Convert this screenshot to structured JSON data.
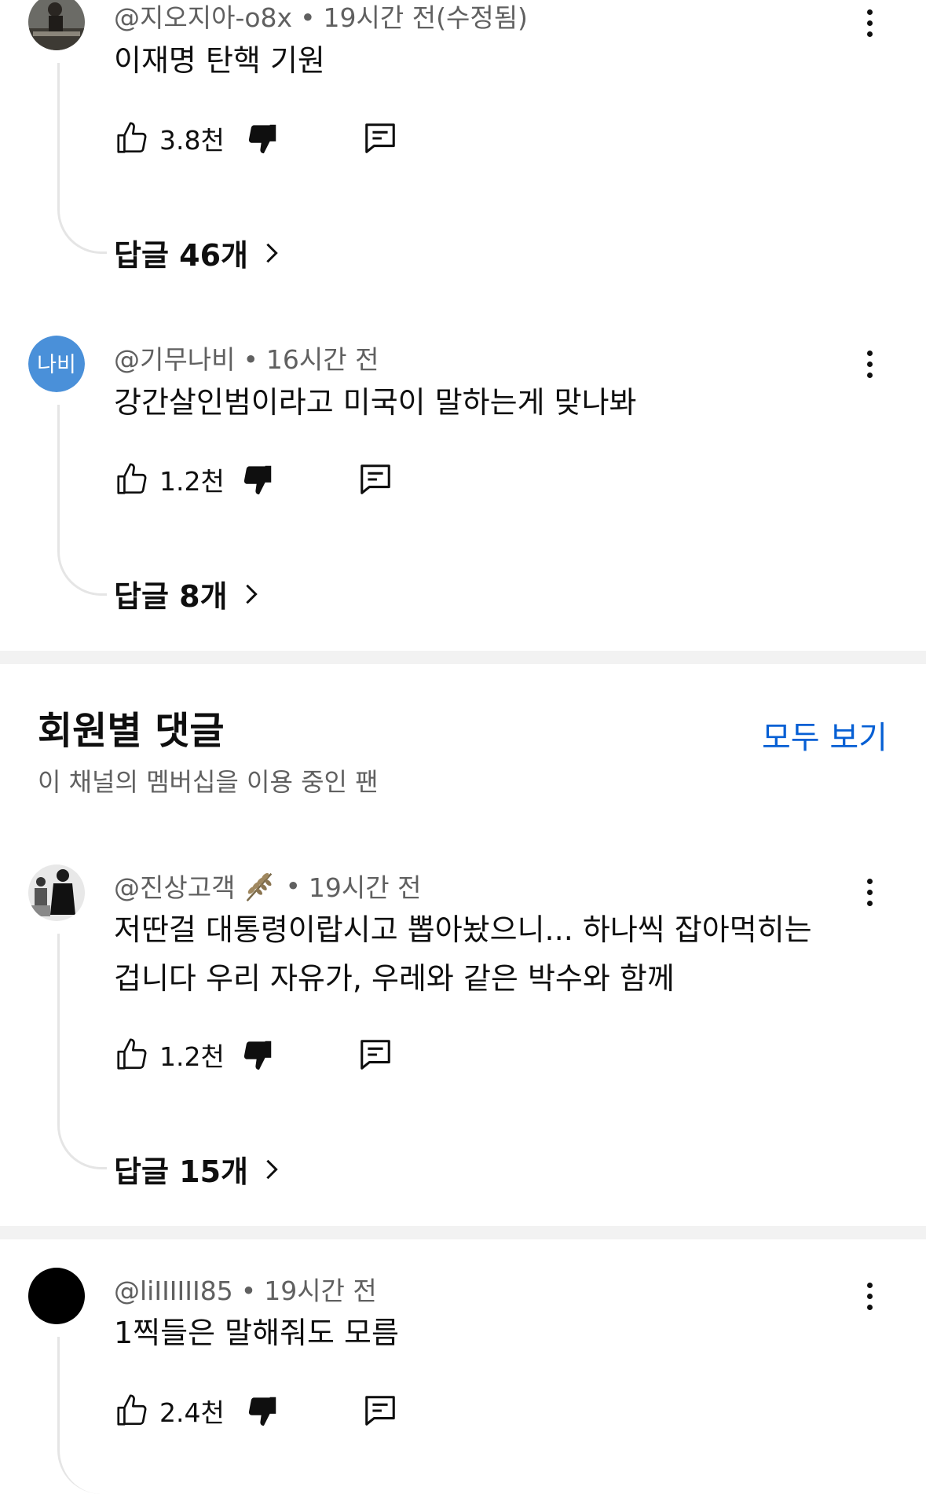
{
  "comments_top": [
    {
      "handle": "@지오지아-o8x",
      "time": "19시간 전(수정됨)",
      "text": "이재명 탄핵 기원",
      "likes": "3.8천",
      "replies": "답글 46개"
    },
    {
      "handle": "@기무나비",
      "time": "16시간 전",
      "text": "강간살인범이라고 미국이 말하는게 맞나봐",
      "likes": "1.2천",
      "replies": "답글 8개",
      "avatar_text": "나비",
      "avatar_color": "#4a90d9"
    }
  ],
  "members_section": {
    "title": "회원별 댓글",
    "see_all": "모두 보기",
    "subtitle": "이 채널의 멤버십을 이용 중인 팬"
  },
  "comments_bottom": [
    {
      "handle": "@진상고객",
      "badge_icon": "wheat-badge-icon",
      "time": "19시간 전",
      "text": "저딴걸 대통령이랍시고 뽑아놨으니... 하나씩 잡아먹히는 겁니다 우리 자유가, 우레와 같은 박수와 함께",
      "likes": "1.2천",
      "replies": "답글 15개"
    },
    {
      "handle": "@liIIIIII85",
      "time": "19시간 전",
      "text": "1찍들은 말해줘도 모름",
      "likes": "2.4천"
    }
  ],
  "separator": "•",
  "colors": {
    "link_blue": "#065fd4",
    "meta_gray": "#606060",
    "divider_gray": "#f2f2f2"
  }
}
